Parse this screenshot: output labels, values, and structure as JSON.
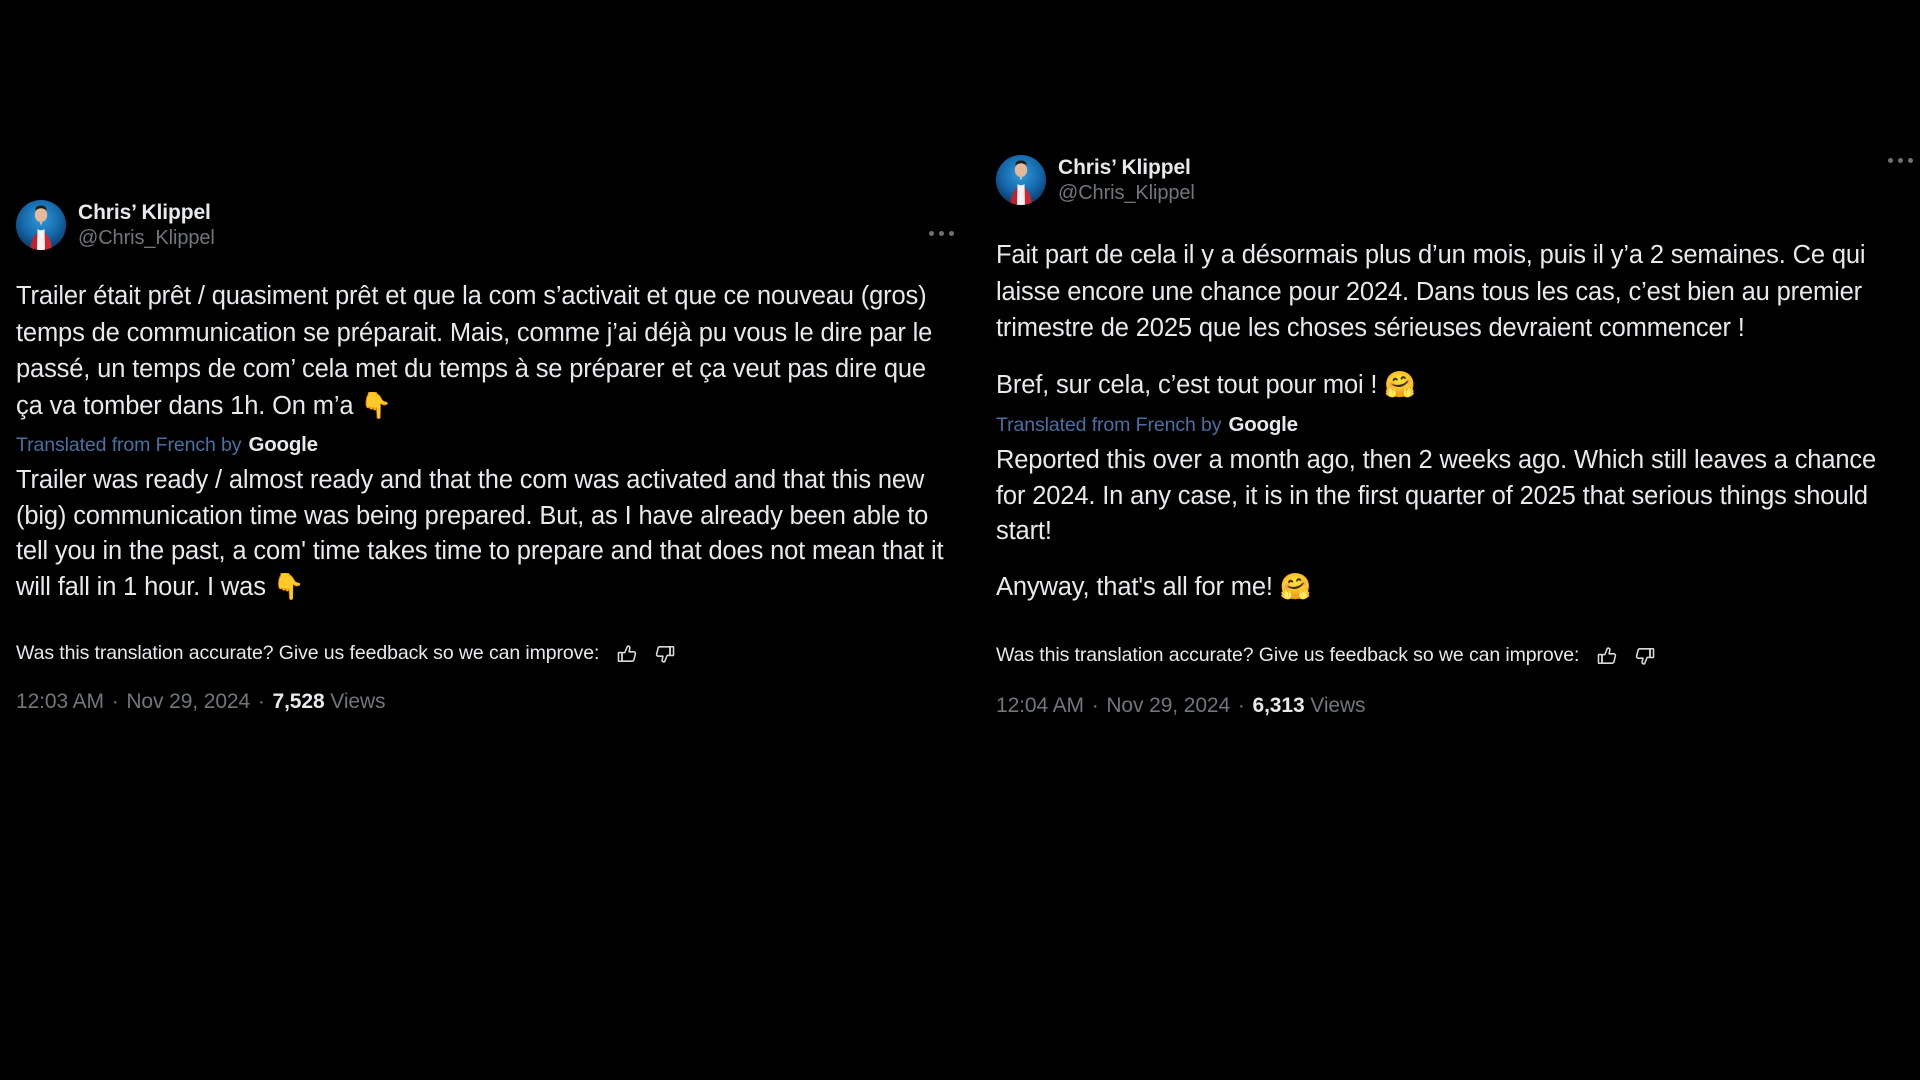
{
  "theme": {
    "background": "#000000",
    "text_primary": "#e7e9ea",
    "text_muted": "#71767b",
    "translate_link": "#4a6fa1"
  },
  "posts": [
    {
      "id": "post-left",
      "author": {
        "display_name": "Chris’ Klippel",
        "handle": "@Chris_Klippel",
        "avatar_alt": "chris-klippel-avatar"
      },
      "more_menu_label": "",
      "original_text": "Trailer était prêt / quasiment prêt et que la com s’activait et que ce nouveau (gros) temps de communication se préparait. Mais, comme j’ai déjà pu vous le dire par le passé, un temps de com’ cela met du temps à se préparer et ça veut pas dire que ça va tomber dans 1h. On m’a 👇",
      "translation_notice": "Translated from French by",
      "translation_provider": "Google",
      "translated_text": "Trailer was ready / almost ready and that the com was activated and that this new (big) communication time was being prepared. But, as I have already been able to tell you in the past, a com' time takes time to prepare and that does not mean that it will fall in 1 hour. I was 👇",
      "feedback_prompt": "Was this translation accurate? Give us feedback so we can improve:",
      "thumbs_up_label": "thumbs-up",
      "thumbs_down_label": "thumbs-down",
      "time": "12:03 AM",
      "date": "Nov 29, 2024",
      "views_count": "7,528",
      "views_label": "Views"
    },
    {
      "id": "post-right",
      "author": {
        "display_name": "Chris’ Klippel",
        "handle": "@Chris_Klippel",
        "avatar_alt": "chris-klippel-avatar"
      },
      "more_menu_label": "",
      "original_text": "Fait part de cela il y a désormais plus d’un mois, puis il y’a 2 semaines. Ce qui laisse encore une chance pour 2024. Dans tous les cas, c’est bien au premier trimestre de 2025 que les choses sérieuses devraient commencer !",
      "original_text_2": "Bref, sur cela, c’est tout pour moi ! 🤗",
      "translation_notice": "Translated from French by",
      "translation_provider": "Google",
      "translated_text": "Reported this over a month ago, then 2 weeks ago. Which still leaves a chance for 2024. In any case, it is in the first quarter of 2025 that serious things should start!",
      "translated_text_2": "Anyway, that's all for me! 🤗",
      "feedback_prompt": "Was this translation accurate? Give us feedback so we can improve:",
      "thumbs_up_label": "thumbs-up",
      "thumbs_down_label": "thumbs-down",
      "time": "12:04 AM",
      "date": "Nov 29, 2024",
      "views_count": "6,313",
      "views_label": "Views"
    }
  ],
  "separators": {
    "middot": "·"
  }
}
